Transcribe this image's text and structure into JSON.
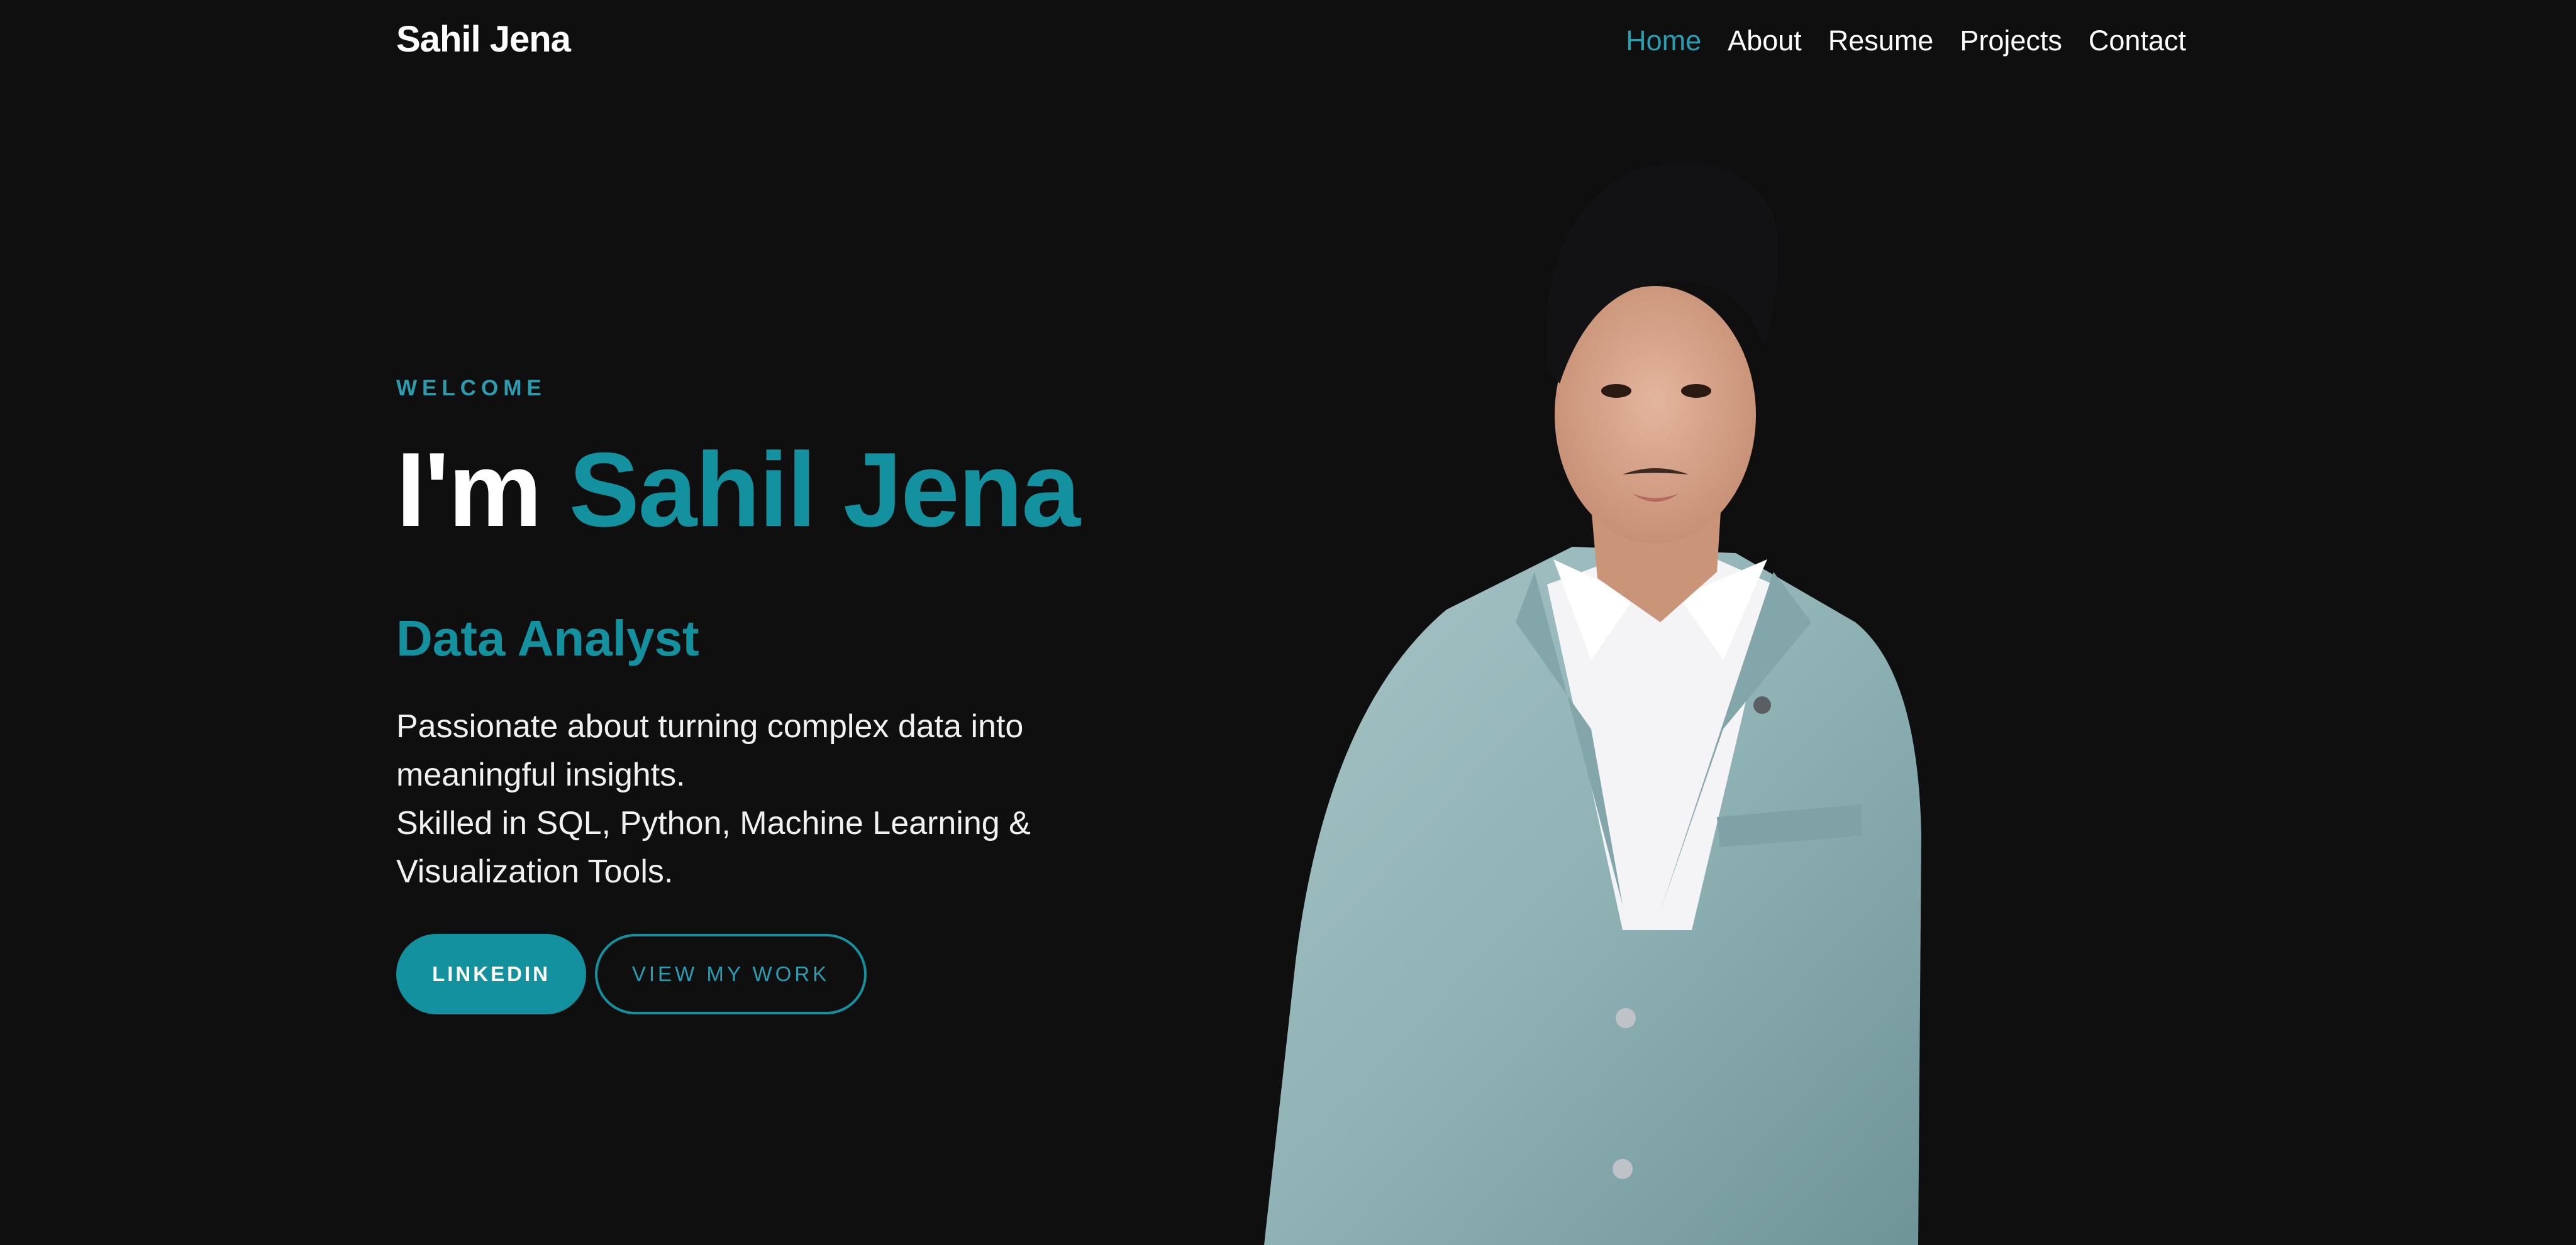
{
  "nav": {
    "logo": "Sahil Jena",
    "links": [
      {
        "label": "Home",
        "active": true
      },
      {
        "label": "About",
        "active": false
      },
      {
        "label": "Resume",
        "active": false
      },
      {
        "label": "Projects",
        "active": false
      },
      {
        "label": "Contact",
        "active": false
      }
    ]
  },
  "hero": {
    "eyebrow": "WELCOME",
    "headline_prefix": "I'm",
    "headline_name": "Sahil Jena",
    "role": "Data Analyst",
    "description_lines": [
      "Passionate about turning complex data into meaningful insights.",
      "Skilled in SQL, Python, Machine Learning & Visualization Tools."
    ],
    "buttons": {
      "primary": "LINKEDIN",
      "secondary": "VIEW MY WORK"
    }
  },
  "colors": {
    "background": "#0f0f10",
    "accent": "#14919f",
    "accent_light": "#2a9db0",
    "text": "#ffffff",
    "blazer": "#8fb2b5"
  },
  "portrait": {
    "icon": "person-portrait-photo"
  }
}
